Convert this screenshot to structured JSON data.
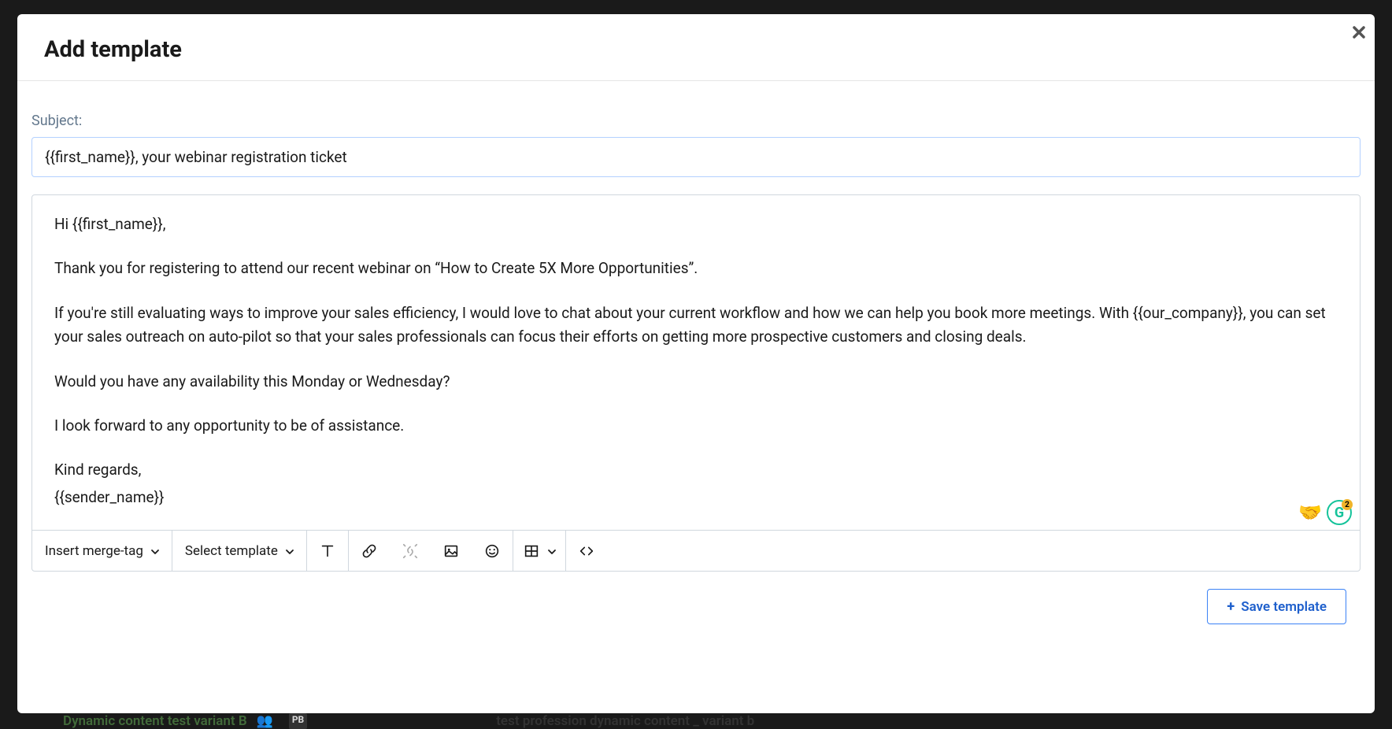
{
  "modal": {
    "title": "Add template",
    "subject_label": "Subject:",
    "subject_value": "{{first_name}}, your webinar registration ticket",
    "body": {
      "greeting": "Hi {{first_name}},",
      "p1": "Thank you for registering to attend our recent webinar on “How to Create 5X More Opportunities”.",
      "p2": "If you're still evaluating ways to improve your sales efficiency, I would love to chat about your current workflow and how we can help you book more meetings. With {{our_company}}, you can set your sales outreach on auto-pilot so that your sales professionals can focus their efforts on getting more prospective customers and closing deals.",
      "p3": "Would you have any availability this Monday or Wednesday?",
      "p4": "I look forward to any opportunity to be of assistance.",
      "closing": "Kind regards,",
      "signature": "{{sender_name}}"
    },
    "grammarly_count": "2",
    "grammarly_letter": "G",
    "handshake_emoji": "🤝"
  },
  "toolbar": {
    "merge_tag_label": "Insert merge-tag",
    "select_template_label": "Select template"
  },
  "footer": {
    "save_label": "Save template"
  },
  "background": {
    "left_text": "Dynamic content test variant B",
    "badge": "PB",
    "right_text": "test profession dynamic content _ variant b"
  }
}
